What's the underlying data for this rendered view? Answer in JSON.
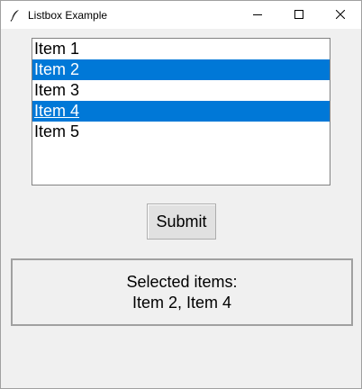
{
  "window": {
    "title": "Listbox Example",
    "icon": "feather-icon",
    "controls": [
      "minimize-icon",
      "maximize-icon",
      "close-icon"
    ]
  },
  "listbox": {
    "items": [
      {
        "label": "Item 1",
        "selected": false
      },
      {
        "label": "Item 2",
        "selected": true
      },
      {
        "label": "Item 3",
        "selected": false
      },
      {
        "label": "Item 4",
        "selected": true
      },
      {
        "label": "Item 5",
        "selected": false
      }
    ],
    "selection_color": "#0078d7"
  },
  "submit": {
    "label": "Submit"
  },
  "result": {
    "heading": "Selected items:",
    "value": "Item 2, Item 4"
  }
}
